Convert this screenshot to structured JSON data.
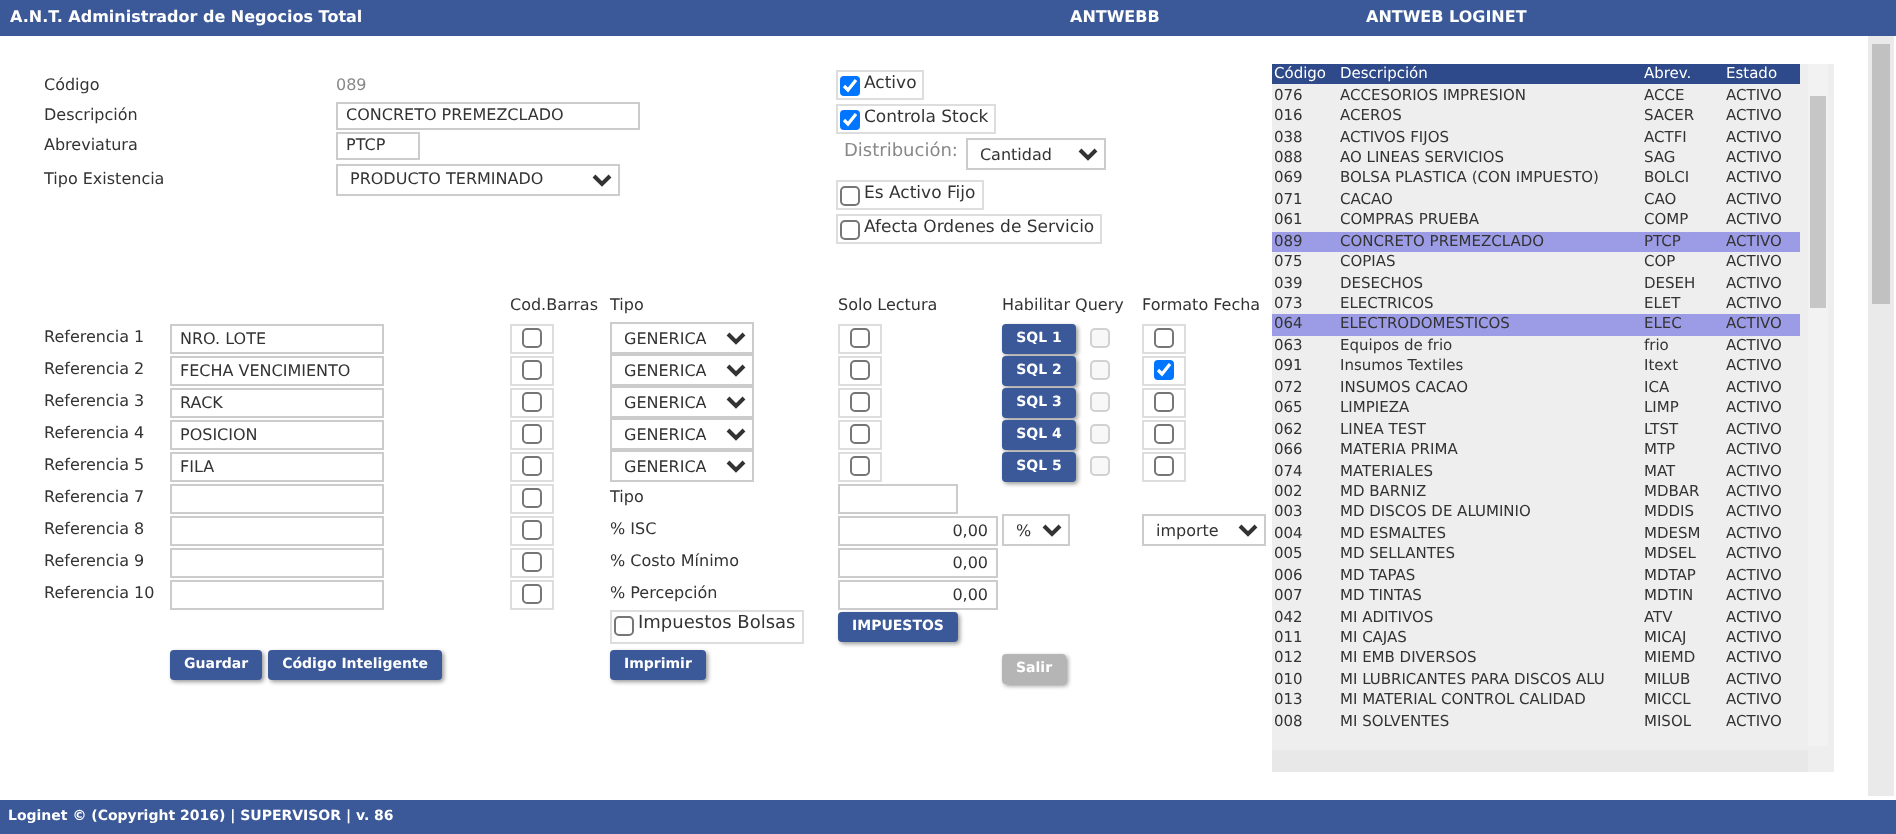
{
  "header": {
    "title": "A.N.T. Administrador de Negocios Total",
    "items": [
      "ANTWEBB",
      "ANTWEB LOGINET"
    ]
  },
  "fields": [
    {
      "kind": "static",
      "label": "Código",
      "value": "089"
    },
    {
      "kind": "input",
      "label": "Descripción",
      "value": "CONCRETO PREMEZCLADO"
    },
    {
      "kind": "short-input",
      "label": "Abreviatura",
      "value": "PTCP"
    },
    {
      "kind": "select",
      "label": "Tipo Existencia",
      "value": "PRODUCTO TERMINADO"
    }
  ],
  "options": [
    {
      "kind": "checkbox",
      "label": "Activo",
      "checked": true
    },
    {
      "kind": "checkbox",
      "label": "Controla Stock",
      "checked": true
    },
    {
      "kind": "select",
      "label": "Distribución:",
      "value": "Cantidad"
    },
    {
      "kind": "checkbox",
      "label": "Es Activo Fijo",
      "checked": false
    },
    {
      "kind": "checkbox",
      "label": "Afecta Ordenes de Servicio",
      "checked": false
    }
  ],
  "reference_columns": [
    "Cod.Barras",
    "Tipo",
    "Solo Lectura",
    "Habilitar Query",
    "Formato Fecha"
  ],
  "references": [
    {
      "label": "Referencia 1",
      "value": "NRO. LOTE",
      "barcode": false,
      "tipo": "GENERICA",
      "read_only": false,
      "query_button": "SQL 1",
      "query_checked": false,
      "query_disabled": true,
      "date_format": false
    },
    {
      "label": "Referencia 2",
      "value": "FECHA VENCIMIENTO",
      "barcode": false,
      "tipo": "GENERICA",
      "read_only": false,
      "query_button": "SQL 2",
      "query_checked": false,
      "query_disabled": true,
      "date_format": true
    },
    {
      "label": "Referencia 3",
      "value": "RACK",
      "barcode": false,
      "tipo": "GENERICA",
      "read_only": false,
      "query_button": "SQL 3",
      "query_checked": false,
      "query_disabled": true,
      "date_format": false
    },
    {
      "label": "Referencia 4",
      "value": "POSICION",
      "barcode": false,
      "tipo": "GENERICA",
      "read_only": false,
      "query_button": "SQL 4",
      "query_checked": false,
      "query_disabled": true,
      "date_format": false
    },
    {
      "label": "Referencia 5",
      "value": "FILA",
      "barcode": false,
      "tipo": "GENERICA",
      "read_only": false,
      "query_button": "SQL 5",
      "query_checked": false,
      "query_disabled": true,
      "date_format": false
    },
    {
      "label": "Referencia 7",
      "barcode": false
    },
    {
      "label": "Referencia 8",
      "barcode": false
    },
    {
      "label": "Referencia 9",
      "barcode": false
    },
    {
      "label": "Referencia 10",
      "barcode": false
    }
  ],
  "taxes": [
    {
      "label": "Tipo",
      "kind": "short"
    },
    {
      "label": "% ISC",
      "value": "0,00",
      "kind": "number",
      "unit_select": "%",
      "amount_select": "importe"
    },
    {
      "label": "% Costo Mínimo",
      "value": "0,00",
      "kind": "number"
    },
    {
      "label": "% Percepción",
      "value": "0,00",
      "kind": "number"
    }
  ],
  "bag_tax": {
    "label": "Impuestos Bolsas",
    "checked": false,
    "button": "IMPUESTOS"
  },
  "buttons": [
    {
      "label": "Guardar",
      "disabled": false
    },
    {
      "label": "Código Inteligente",
      "disabled": false
    },
    {
      "label": "Imprimir",
      "disabled": false
    },
    {
      "label": "Salir",
      "disabled": true
    }
  ],
  "table": {
    "columns": [
      "Código",
      "Descripción",
      "Abrev.",
      "Estado"
    ],
    "rows": [
      {
        "cells": [
          "076",
          "ACCESORIOS IMPRESION",
          "ACCE",
          "ACTIVO"
        ],
        "selected": false
      },
      {
        "cells": [
          "016",
          "ACEROS",
          "SACER",
          "ACTIVO"
        ],
        "selected": false
      },
      {
        "cells": [
          "038",
          "ACTIVOS FIJOS",
          "ACTFI",
          "ACTIVO"
        ],
        "selected": false
      },
      {
        "cells": [
          "088",
          "AO LINEAS SERVICIOS",
          "SAG",
          "ACTIVO"
        ],
        "selected": false
      },
      {
        "cells": [
          "069",
          "BOLSA PLASTICA (CON IMPUESTO)",
          "BOLCI",
          "ACTIVO"
        ],
        "selected": false
      },
      {
        "cells": [
          "071",
          "CACAO",
          "CAO",
          "ACTIVO"
        ],
        "selected": false
      },
      {
        "cells": [
          "061",
          "COMPRAS PRUEBA",
          "COMP",
          "ACTIVO"
        ],
        "selected": false
      },
      {
        "cells": [
          "089",
          "CONCRETO PREMEZCLADO",
          "PTCP",
          "ACTIVO"
        ],
        "selected": true
      },
      {
        "cells": [
          "075",
          "COPIAS",
          "COP",
          "ACTIVO"
        ],
        "selected": false
      },
      {
        "cells": [
          "039",
          "DESECHOS",
          "DESEH",
          "ACTIVO"
        ],
        "selected": false
      },
      {
        "cells": [
          "073",
          "ELECTRICOS",
          "ELET",
          "ACTIVO"
        ],
        "selected": false
      },
      {
        "cells": [
          "064",
          "ELECTRODOMESTICOS",
          "ELEC",
          "ACTIVO"
        ],
        "selected": true
      },
      {
        "cells": [
          "063",
          "Equipos de frio",
          "frio",
          "ACTIVO"
        ],
        "selected": false
      },
      {
        "cells": [
          "091",
          "Insumos Textiles",
          "Itext",
          "ACTIVO"
        ],
        "selected": false
      },
      {
        "cells": [
          "072",
          "INSUMOS CACAO",
          "ICA",
          "ACTIVO"
        ],
        "selected": false
      },
      {
        "cells": [
          "065",
          "LIMPIEZA",
          "LIMP",
          "ACTIVO"
        ],
        "selected": false
      },
      {
        "cells": [
          "062",
          "LINEA TEST",
          "LTST",
          "ACTIVO"
        ],
        "selected": false
      },
      {
        "cells": [
          "066",
          "MATERIA PRIMA",
          "MTP",
          "ACTIVO"
        ],
        "selected": false
      },
      {
        "cells": [
          "074",
          "MATERIALES",
          "MAT",
          "ACTIVO"
        ],
        "selected": false
      },
      {
        "cells": [
          "002",
          "MD BARNIZ",
          "MDBAR",
          "ACTIVO"
        ],
        "selected": false
      },
      {
        "cells": [
          "003",
          "MD DISCOS DE ALUMINIO",
          "MDDIS",
          "ACTIVO"
        ],
        "selected": false
      },
      {
        "cells": [
          "004",
          "MD ESMALTES",
          "MDESM",
          "ACTIVO"
        ],
        "selected": false
      },
      {
        "cells": [
          "005",
          "MD SELLANTES",
          "MDSEL",
          "ACTIVO"
        ],
        "selected": false
      },
      {
        "cells": [
          "006",
          "MD TAPAS",
          "MDTAP",
          "ACTIVO"
        ],
        "selected": false
      },
      {
        "cells": [
          "007",
          "MD TINTAS",
          "MDTIN",
          "ACTIVO"
        ],
        "selected": false
      },
      {
        "cells": [
          "042",
          "MI ADITIVOS",
          "ATV",
          "ACTIVO"
        ],
        "selected": false
      },
      {
        "cells": [
          "011",
          "MI CAJAS",
          "MICAJ",
          "ACTIVO"
        ],
        "selected": false
      },
      {
        "cells": [
          "012",
          "MI EMB DIVERSOS",
          "MIEMD",
          "ACTIVO"
        ],
        "selected": false
      },
      {
        "cells": [
          "010",
          "MI LUBRICANTES PARA DISCOS ALU",
          "MILUB",
          "ACTIVO"
        ],
        "selected": false
      },
      {
        "cells": [
          "013",
          "MI MATERIAL CONTROL CALIDAD",
          "MICCL",
          "ACTIVO"
        ],
        "selected": false
      },
      {
        "cells": [
          "008",
          "MI SOLVENTES",
          "MISOL",
          "ACTIVO"
        ],
        "selected": false
      }
    ]
  },
  "footer": "Loginet © (Copyright 2016) | SUPERVISOR | v. 86"
}
